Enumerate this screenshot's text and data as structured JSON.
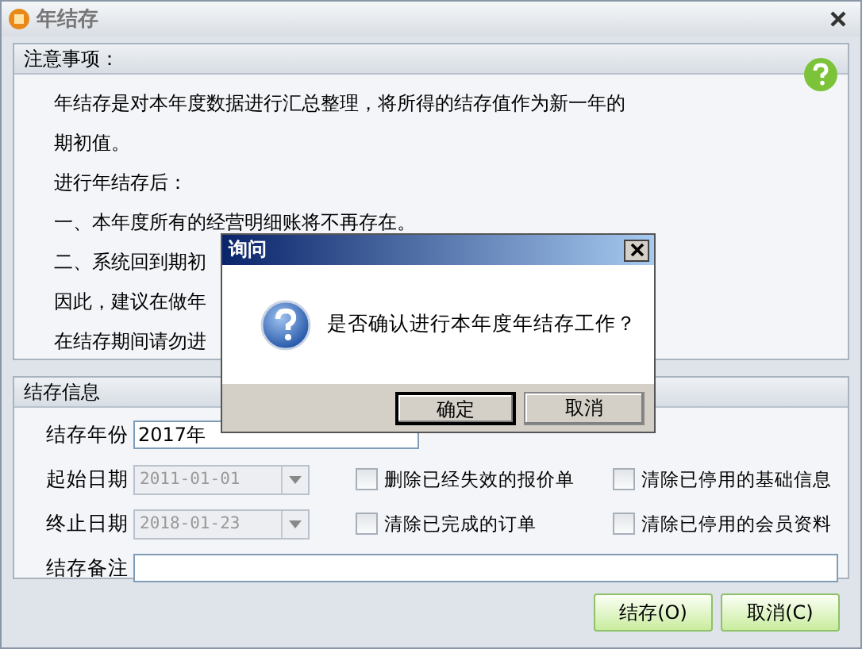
{
  "window": {
    "title": "年结存"
  },
  "notes": {
    "heading": "注意事项：",
    "lines": [
      "年结存是对本年度数据进行汇总整理，将所得的结存值作为新一年的",
      "期初值。",
      "进行年结存后：",
      "一、本年度所有的经营明细账将不再存在。",
      "二、系统回到期初",
      "因此，建议在做年",
      "在结存期间请勿进"
    ]
  },
  "info": {
    "heading": "结存信息",
    "year": {
      "label": "结存年份",
      "value": "2017年"
    },
    "dates": [
      {
        "label": "起始日期",
        "value": "2011-01-01",
        "disabled": true
      },
      {
        "label": "终止日期",
        "value": "2018-01-23",
        "disabled": true
      }
    ],
    "options": [
      {
        "label": "删除已经失效的报价单",
        "checked": false
      },
      {
        "label": "清除已停用的基础信息",
        "checked": false
      },
      {
        "label": "清除已完成的订单",
        "checked": false
      },
      {
        "label": "清除已停用的会员资料",
        "checked": false
      }
    ],
    "remark": {
      "label": "结存备注"
    }
  },
  "buttons": [
    {
      "label": "结存(O)"
    },
    {
      "label": "取消(C)"
    }
  ],
  "dialog": {
    "title": "询问",
    "message": "是否确认进行本年度年结存工作？",
    "buttons": [
      {
        "label": "确定",
        "selected": true
      },
      {
        "label": "取消",
        "selected": false
      }
    ]
  }
}
